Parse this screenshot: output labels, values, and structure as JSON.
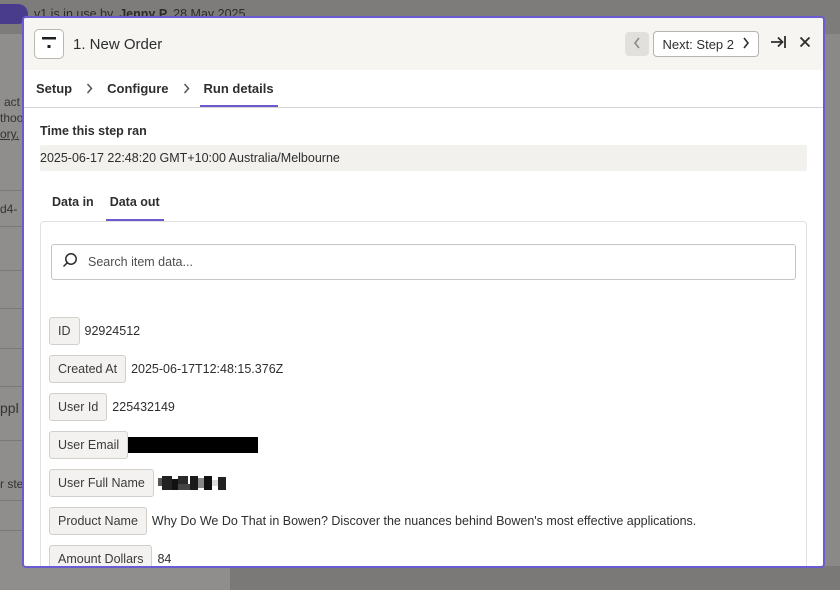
{
  "background": {
    "banner_prefix": "v1  is in use by",
    "banner_user": "Jenny P",
    "banner_date": "28 May 2025",
    "fragments": [
      "act",
      "thoo",
      "ory.",
      "d4-",
      "ppl",
      "r ste"
    ]
  },
  "modal": {
    "title": "1. New Order",
    "prev_icon": "chevron-left-icon",
    "next_label": "Next: Step 2",
    "next_icon": "chevron-right-icon",
    "expand_icon": "arrow-right-bar-icon",
    "close_icon": "close-icon",
    "steps": [
      {
        "label": "Setup",
        "active": false
      },
      {
        "label": "Configure",
        "active": false
      },
      {
        "label": "Run details",
        "active": true
      }
    ],
    "accent_color": "#6a5bd3"
  },
  "run": {
    "label": "Time this step ran",
    "value": "2025-06-17 22:48:20 GMT+10:00 Australia/Melbourne"
  },
  "data_tabs": [
    {
      "label": "Data in",
      "active": false
    },
    {
      "label": "Data out",
      "active": true
    }
  ],
  "search": {
    "placeholder": "Search item data...",
    "icon": "search-icon"
  },
  "fields": [
    {
      "key": "ID",
      "value": "92924512"
    },
    {
      "key": "Created At",
      "value": "2025-06-17T12:48:15.376Z"
    },
    {
      "key": "User Id",
      "value": "225432149"
    },
    {
      "key": "User Email",
      "value": "",
      "redacted": "black-bar"
    },
    {
      "key": "User Full Name",
      "value": "",
      "redacted": "pixelated"
    },
    {
      "key": "Product Name",
      "value": "Why Do We Do That in Bowen? Discover the nuances behind Bowen's most effective applications."
    },
    {
      "key": "Amount Dollars",
      "value": "84"
    }
  ]
}
